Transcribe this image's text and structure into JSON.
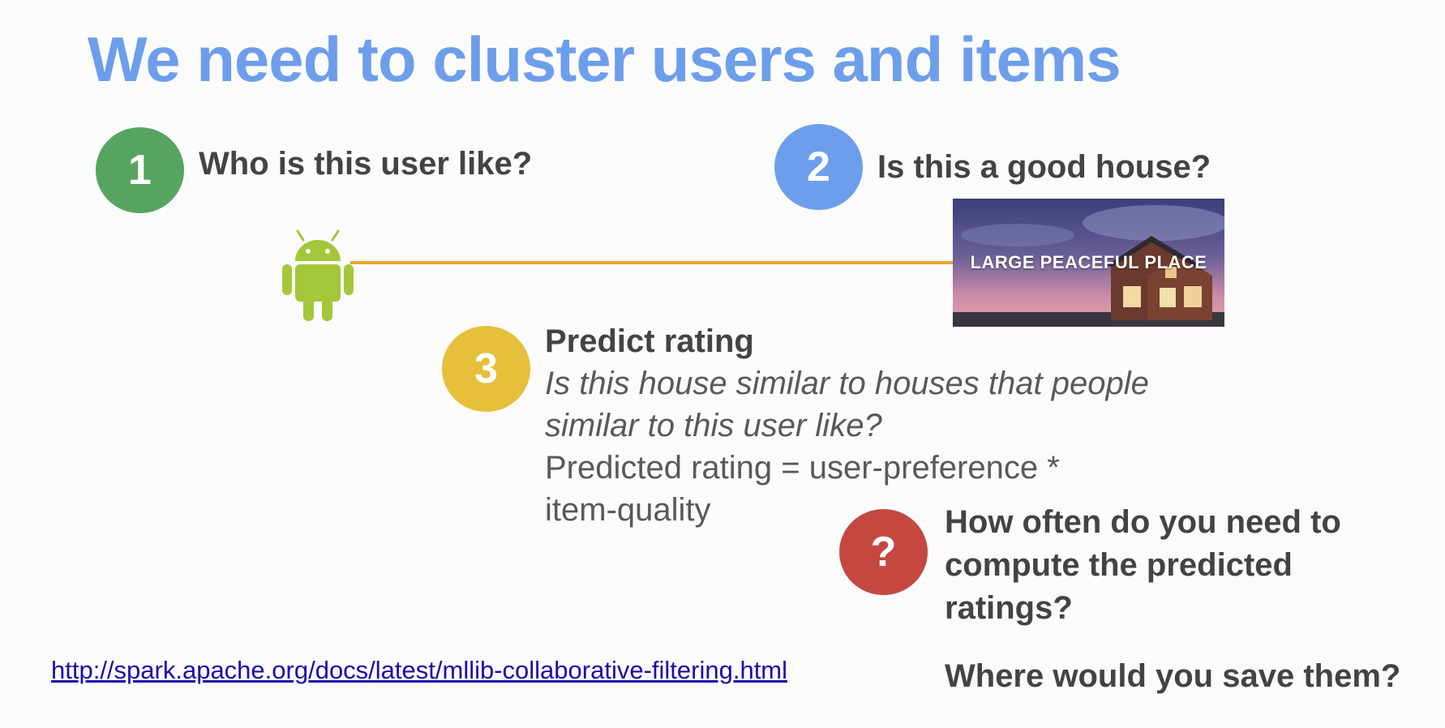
{
  "slide": {
    "title": "We need to cluster users and items",
    "steps": [
      {
        "badge": "1",
        "text": "Who is this user like?",
        "color": "#57a460"
      },
      {
        "badge": "2",
        "text": "Is this a good house?",
        "color": "#6d9eeb"
      },
      {
        "badge": "3",
        "text": "Predict rating",
        "color": "#e6c03b"
      }
    ],
    "house_image_caption": "LARGE PEACEFUL PLACE",
    "predict": {
      "italic": "Is this house similar to houses that people similar to this user like?",
      "formula_line1": "Predicted rating = user-preference *",
      "formula_line2": "item-quality"
    },
    "question": {
      "badge": "?",
      "color": "#c4483f",
      "text": "How often do you need to compute the predicted ratings?",
      "followup": "Where would you save them?"
    },
    "link": "http://spark.apache.org/docs/latest/mllib-collaborative-filtering.html",
    "icons": {
      "user": "android-robot-icon",
      "item": "house-photo"
    },
    "colors": {
      "title": "#6d9eeb",
      "connector": "#e9a52b",
      "android": "#a4c639"
    }
  }
}
